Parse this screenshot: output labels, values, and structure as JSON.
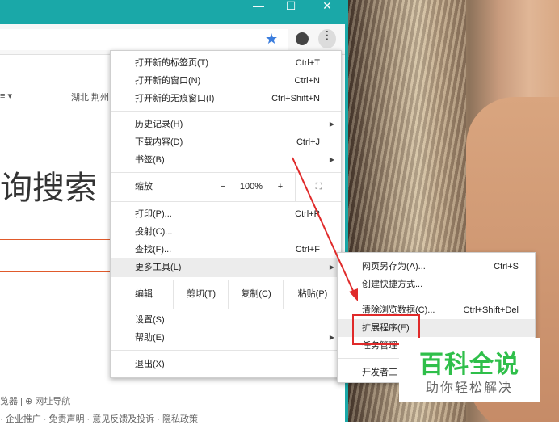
{
  "window": {
    "min": "—",
    "max": "☐",
    "close": "✕"
  },
  "page": {
    "left_fragment": "≡ ▾",
    "location": "湖北 荆州",
    "big_text": "询搜索",
    "footer_line1": "览器 | ⊕ 网址导航",
    "footer_line2": "· 企业推广 · 免责声明 · 意见反馈及投诉 · 隐私政策"
  },
  "menu": {
    "items": [
      {
        "label": "打开新的标签页(T)",
        "shortcut": "Ctrl+T"
      },
      {
        "label": "打开新的窗口(N)",
        "shortcut": "Ctrl+N"
      },
      {
        "label": "打开新的无痕窗口(I)",
        "shortcut": "Ctrl+Shift+N"
      },
      {
        "label": "历史记录(H)",
        "shortcut": ""
      },
      {
        "label": "下载内容(D)",
        "shortcut": "Ctrl+J"
      },
      {
        "label": "书签(B)",
        "shortcut": ""
      },
      {
        "label": "打印(P)...",
        "shortcut": "Ctrl+P"
      },
      {
        "label": "投射(C)...",
        "shortcut": ""
      },
      {
        "label": "查找(F)...",
        "shortcut": "Ctrl+F"
      },
      {
        "label": "更多工具(L)",
        "shortcut": ""
      },
      {
        "label": "设置(S)",
        "shortcut": ""
      },
      {
        "label": "帮助(E)",
        "shortcut": ""
      },
      {
        "label": "退出(X)",
        "shortcut": ""
      }
    ],
    "zoom": {
      "label": "缩放",
      "minus": "−",
      "value": "100%",
      "plus": "+",
      "fullscreen": "⛶"
    },
    "edit": {
      "label": "编辑",
      "cut": "剪切(T)",
      "copy": "复制(C)",
      "paste": "粘贴(P)"
    }
  },
  "submenu": {
    "items": [
      {
        "label": "网页另存为(A)...",
        "shortcut": "Ctrl+S"
      },
      {
        "label": "创建快捷方式...",
        "shortcut": ""
      },
      {
        "label": "清除浏览数据(C)...",
        "shortcut": "Ctrl+Shift+Del"
      },
      {
        "label": "扩展程序(E)",
        "shortcut": ""
      },
      {
        "label": "任务管理",
        "shortcut": ""
      },
      {
        "label": "开发者工",
        "shortcut": ""
      }
    ]
  },
  "watermark": {
    "title": "百科全说",
    "subtitle": "助你轻松解决"
  },
  "colors": {
    "titlebar": "#1aa8a8",
    "accent_star": "#3b7ddd",
    "highlight_box": "#e02a2a",
    "watermark": "#2fbf4a"
  }
}
